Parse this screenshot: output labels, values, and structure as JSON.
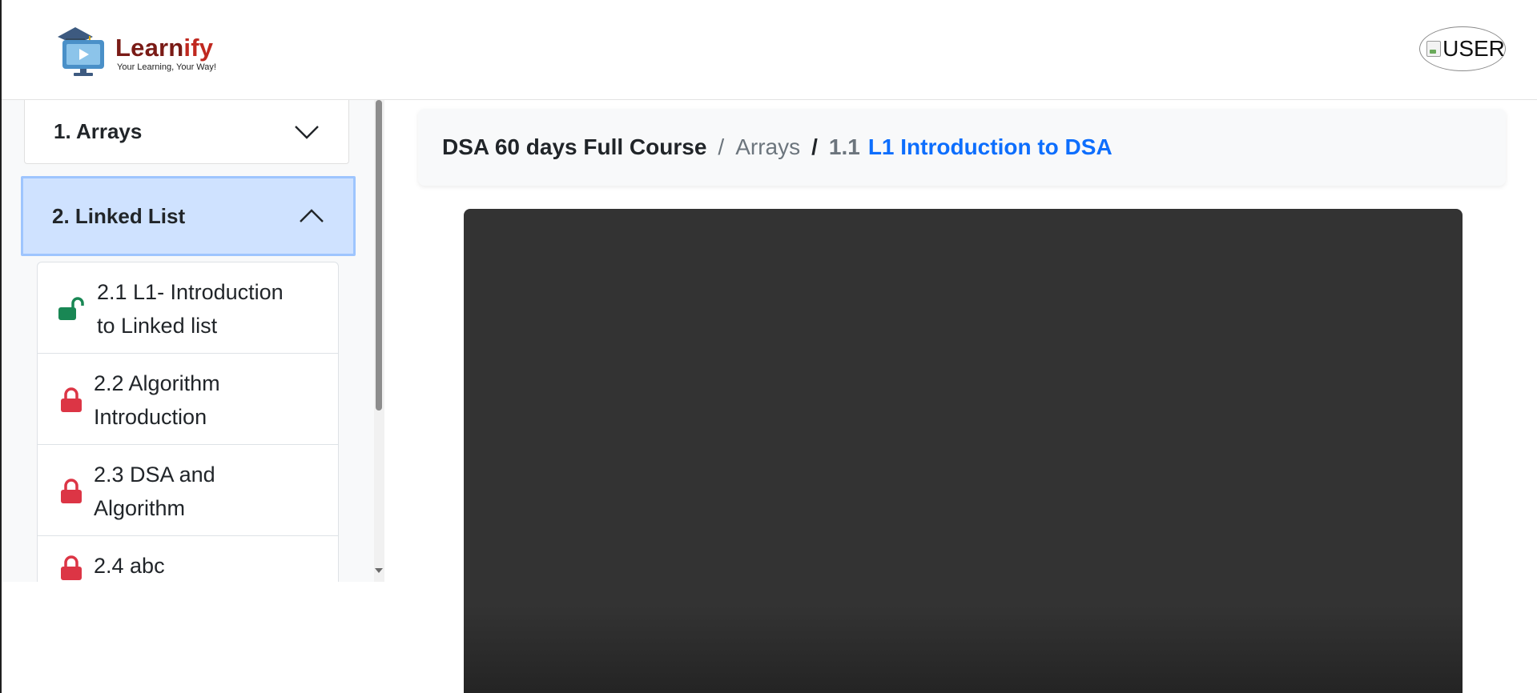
{
  "header": {
    "brand_main": "Learn",
    "brand_accent": "ify",
    "tagline": "Your Learning, Your Way!",
    "user_label": "USER"
  },
  "sidebar": {
    "sections": [
      {
        "label": "1. Arrays",
        "expanded": false
      },
      {
        "label": "2. Linked List",
        "expanded": true
      }
    ],
    "lessons": [
      {
        "label": "2.1 L1- Introduction to Linked list",
        "line1": "2.1 L1- Introduction",
        "line2": "to Linked list",
        "status": "unlocked"
      },
      {
        "label": "2.2 Algorithm Introduction",
        "line1": "2.2 Algorithm",
        "line2": "Introduction",
        "status": "locked"
      },
      {
        "label": "2.3 DSA and Algorithm",
        "line1": "2.3 DSA and",
        "line2": "Algorithm",
        "status": "locked"
      },
      {
        "label": "2.4 abc",
        "line1": "2.4 abc",
        "line2": "",
        "status": "locked"
      }
    ]
  },
  "breadcrumb": {
    "course": "DSA 60 days Full Course",
    "separator": "/",
    "topic": "Arrays",
    "lesson_number": "1.1",
    "lesson_title": "L1 Introduction to DSA"
  },
  "colors": {
    "brand": "#7a1b16",
    "active_section": "#cfe2ff",
    "lock_locked": "#dc3545",
    "lock_unlocked": "#198754",
    "link": "#0d6efd",
    "video_bg": "#333333"
  }
}
